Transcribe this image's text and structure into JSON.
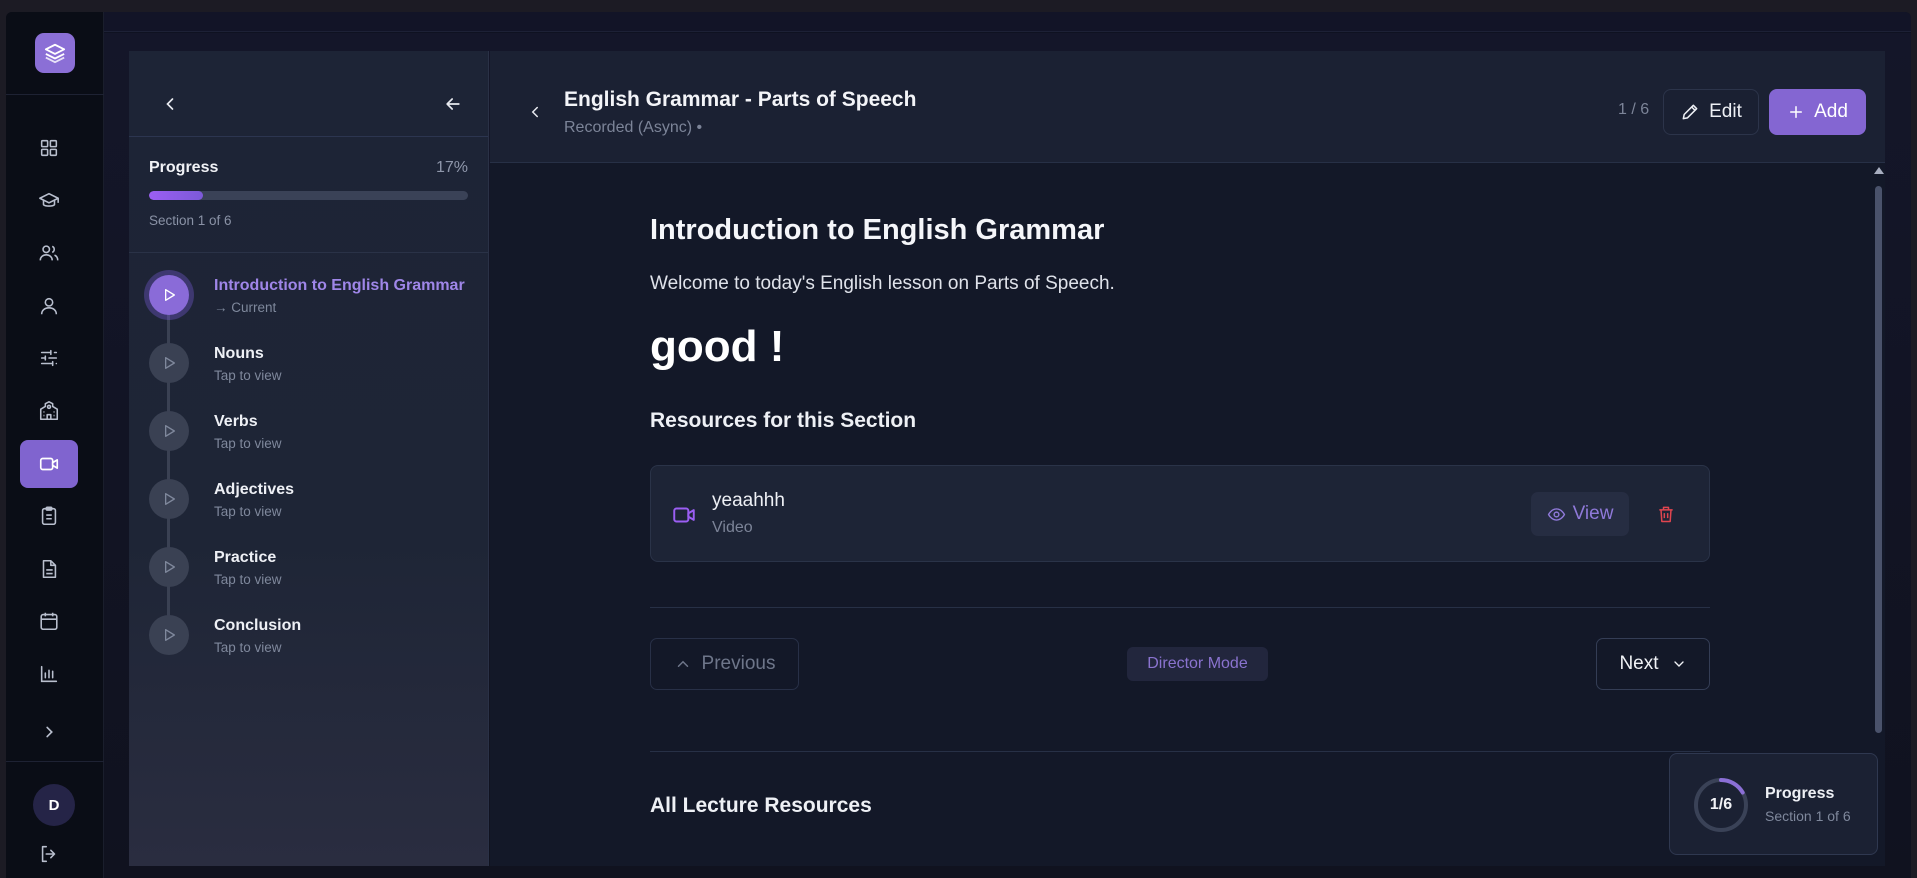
{
  "rail": {
    "logo_icon": "layers-icon",
    "items": [
      {
        "icon": "grid-icon",
        "active": false
      },
      {
        "icon": "graduation-cap-icon",
        "active": false
      },
      {
        "icon": "users-icon",
        "active": false
      },
      {
        "icon": "user-icon",
        "active": false
      },
      {
        "icon": "sliders-icon",
        "active": false
      },
      {
        "icon": "school-icon",
        "active": false
      },
      {
        "icon": "video-icon",
        "active": true
      },
      {
        "icon": "clipboard-icon",
        "active": false
      },
      {
        "icon": "document-icon",
        "active": false
      },
      {
        "icon": "calendar-icon",
        "active": false
      },
      {
        "icon": "bar-chart-icon",
        "active": false
      },
      {
        "icon": "chevron-right-icon",
        "active": false
      }
    ],
    "avatar_initial": "D",
    "logout_icon": "logout-icon"
  },
  "sidebar": {
    "progress_label": "Progress",
    "progress_percent": "17%",
    "progress_value": 0.17,
    "section_text": "Section 1 of 6",
    "lessons": [
      {
        "title": "Introduction to English Grammar",
        "sub": "→ Current",
        "current": true
      },
      {
        "title": "Nouns",
        "sub": "Tap to view",
        "current": false
      },
      {
        "title": "Verbs",
        "sub": "Tap to view",
        "current": false
      },
      {
        "title": "Adjectives",
        "sub": "Tap to view",
        "current": false
      },
      {
        "title": "Practice",
        "sub": "Tap to view",
        "current": false
      },
      {
        "title": "Conclusion",
        "sub": "Tap to view",
        "current": false
      }
    ]
  },
  "header": {
    "title": "English Grammar - Parts of Speech",
    "subtitle": "Recorded (Async) •",
    "counter": "1 / 6",
    "edit_label": "Edit",
    "add_label": "Add"
  },
  "section": {
    "heading": "Introduction to English Grammar",
    "welcome": "Welcome to today's English lesson on Parts of Speech.",
    "big_text": "good !",
    "resources_heading": "Resources for this Section",
    "resource": {
      "name": "yeaahhh",
      "type": "Video",
      "view_label": "View"
    }
  },
  "nav": {
    "previous_label": "Previous",
    "mode_badge": "Director Mode",
    "next_label": "Next"
  },
  "all_resources_heading": "All Lecture Resources",
  "float_progress": {
    "count": "1/6",
    "title": "Progress",
    "sub": "Section 1 of 6",
    "value": 0.1667
  },
  "colors": {
    "accent": "#8466d2",
    "accent_light": "#9f86e8",
    "danger": "#e0454f"
  }
}
